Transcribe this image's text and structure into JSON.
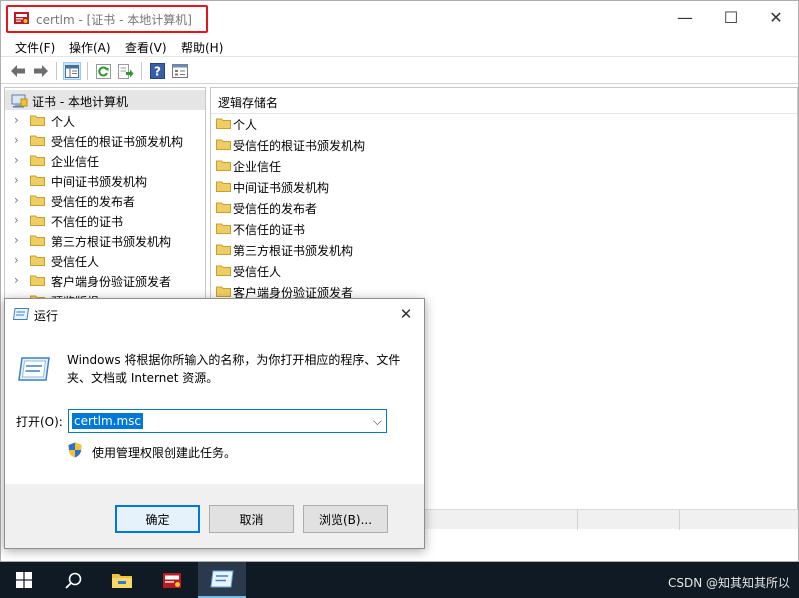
{
  "window": {
    "title": "certlm - [证书 - 本地计算机]",
    "minimize_glyph": "—",
    "maximize_glyph": "☐",
    "close_glyph": "✕",
    "highlight_color": "#e8141c"
  },
  "menu": [
    "文件(F)",
    "操作(A)",
    "查看(V)",
    "帮助(H)"
  ],
  "toolbar": {
    "icons": [
      "back-arrow-icon",
      "forward-arrow-icon",
      "show-hide-tree-icon",
      "refresh-icon",
      "export-list-icon",
      "help-icon",
      "properties-icon"
    ]
  },
  "tree": {
    "root_label": "证书 - 本地计算机",
    "items": [
      "个人",
      "受信任的根证书颁发机构",
      "企业信任",
      "中间证书颁发机构",
      "受信任的发布者",
      "不信任的证书",
      "第三方根证书颁发机构",
      "受信任人",
      "客户端身份验证颁发者",
      "预览版根"
    ]
  },
  "list": {
    "column_header": "逻辑存储名",
    "items": [
      "个人",
      "受信任的根证书颁发机构",
      "企业信任",
      "中间证书颁发机构",
      "受信任的发布者",
      "不信任的证书",
      "第三方根证书颁发机构",
      "受信任人",
      "客户端身份验证颁发者"
    ]
  },
  "run_dialog": {
    "title": "运行",
    "close_glyph": "✕",
    "description": "Windows 将根据你所输入的名称，为你打开相应的程序、文件夹、文档或 Internet 资源。",
    "open_label": "打开(O):",
    "input_value": "certlm.msc",
    "admin_note": "使用管理权限创建此任务。",
    "ok_label": "确定",
    "cancel_label": "取消",
    "browse_label": "浏览(B)..."
  },
  "taskbar": {
    "items": [
      "start-windows-icon",
      "search-icon",
      "file-explorer-icon",
      "certlm-app-icon",
      "run-app-icon"
    ],
    "watermark": "CSDN @知其知其所以"
  },
  "colors": {
    "accent": "#0078d7",
    "folder": "#e8c45b",
    "taskbar": "#101a24"
  }
}
